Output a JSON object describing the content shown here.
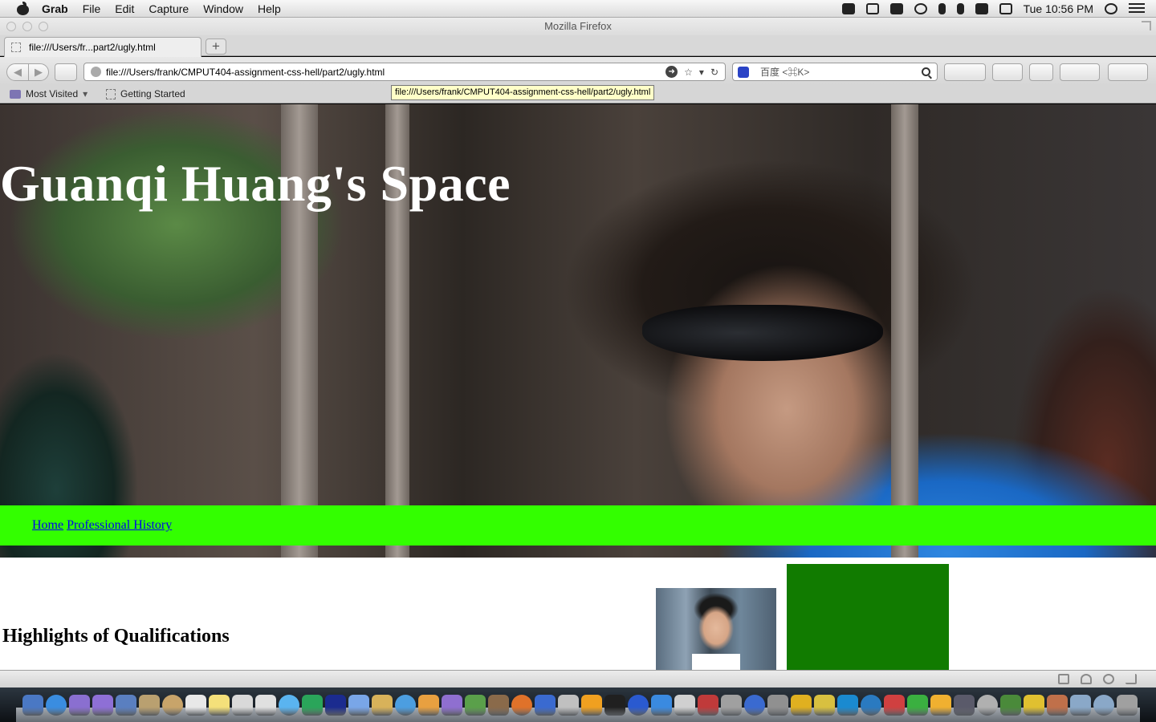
{
  "menubar": {
    "app_name": "Grab",
    "menus": [
      "File",
      "Edit",
      "Capture",
      "Window",
      "Help"
    ],
    "clock": "Tue 10:56 PM"
  },
  "window": {
    "title": "Mozilla Firefox"
  },
  "tab": {
    "label": "file:///Users/fr...part2/ugly.html",
    "new_tab": "+"
  },
  "navbar": {
    "url": "file:///Users/frank/CMPUT404-assignment-css-hell/part2/ugly.html",
    "search_placeholder": "百度 <⌘K>"
  },
  "bookmarks": {
    "most_visited": "Most Visited",
    "getting_started": "Getting Started"
  },
  "tooltip": "file:///Users/frank/CMPUT404-assignment-css-hell/part2/ugly.html",
  "page": {
    "heading": "Guanqi Huang's Space",
    "nav": [
      "Home",
      "Professional History"
    ],
    "section_heading": "Highlights of Qualifications",
    "colors": {
      "nav_bar": "#33ff00",
      "green_box": "#117b00",
      "link": "#0000ee"
    }
  },
  "dock": {
    "icon_colors": [
      "#4a78c4",
      "#3a8de0",
      "#8a6fd0",
      "#8e6fd6",
      "#5a7fc0",
      "#b9a070",
      "#c8a46a",
      "#e8e8e8",
      "#f4e07a",
      "#d9d9d9",
      "#e0e0e0",
      "#5ab4f0",
      "#2aa55a",
      "#1b2b8f",
      "#79a6e8",
      "#d8b25a",
      "#4c9ee0",
      "#e8a040",
      "#8f6fd0",
      "#5aa04a",
      "#8a6a4a",
      "#e0722a",
      "#3a6ad0",
      "#c0c0c0",
      "#f0a020",
      "#202020",
      "#2a5ad0",
      "#3a8ae0",
      "#d0d0d0",
      "#c03a3a",
      "#a0a0a0",
      "#3a6ad0",
      "#909090",
      "#e0b020",
      "#d8c040",
      "#1a8ad0",
      "#2a7ac0",
      "#d04040",
      "#3ab040",
      "#f0b030",
      "#5a5a6a",
      "#b0b0b0",
      "#4a8a3a",
      "#e0c030",
      "#c0704a",
      "#8aa8c8",
      "#8aa8c8",
      "#a0a0a0"
    ]
  }
}
